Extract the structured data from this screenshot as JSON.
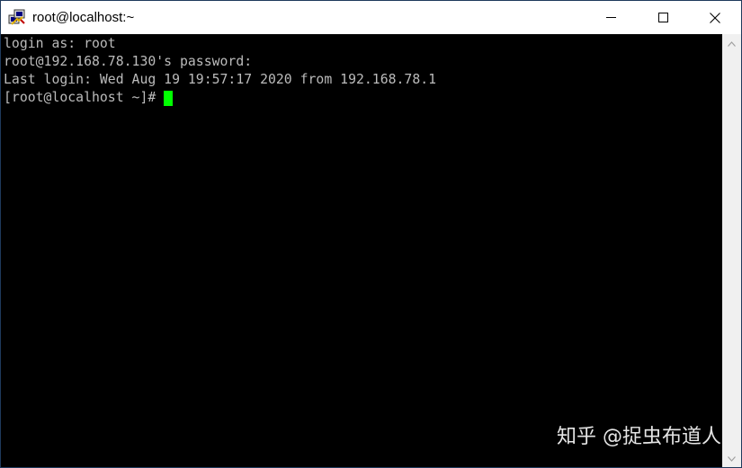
{
  "window": {
    "title": "root@localhost:~",
    "app_icon": "putty-icon"
  },
  "window_controls": {
    "minimize_icon": "minimize-icon",
    "maximize_icon": "maximize-icon",
    "close_icon": "close-icon"
  },
  "terminal": {
    "lines": [
      "login as: root",
      "root@192.168.78.130's password:",
      "Last login: Wed Aug 19 19:57:17 2020 from 192.168.78.1"
    ],
    "prompt": "[root@localhost ~]#",
    "cursor_color": "#00ff00",
    "text_color": "#bbbbbb",
    "background_color": "#000000"
  },
  "scrollbar": {
    "up_icon": "scroll-up-icon",
    "down_icon": "scroll-down-icon"
  },
  "watermark": {
    "text": "知乎 @捉虫布道人"
  }
}
